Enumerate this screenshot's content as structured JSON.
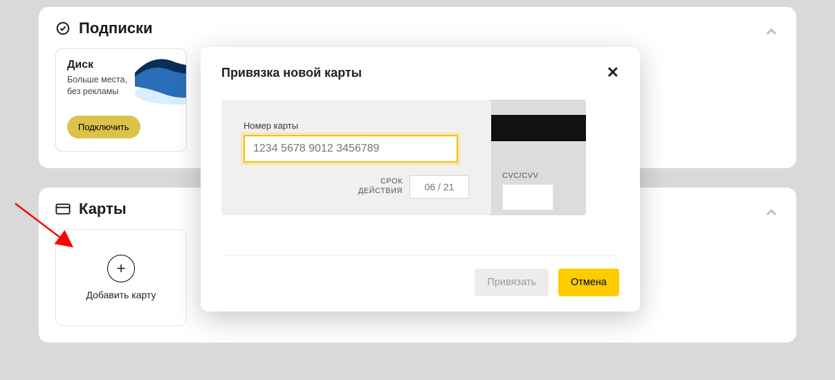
{
  "sections": {
    "subscriptions": {
      "title": "Подписки",
      "tile": {
        "title": "Диск",
        "subtitle": "Больше места,\nбез рекламы",
        "cta": "Подключить"
      }
    },
    "cards": {
      "title": "Карты",
      "add_label": "Добавить карту"
    }
  },
  "modal": {
    "title": "Привязка новой карты",
    "card_number_label": "Номер карты",
    "card_number_placeholder": "1234 5678 9012 3456789",
    "card_number_value": "",
    "expiry_label": "СРОК\nДЕЙСТВИЯ",
    "expiry_placeholder": "06 / 21",
    "expiry_value": "",
    "cvc_label": "CVC/CVV",
    "cvc_value": "",
    "actions": {
      "submit": "Привязать",
      "cancel": "Отмена"
    }
  }
}
